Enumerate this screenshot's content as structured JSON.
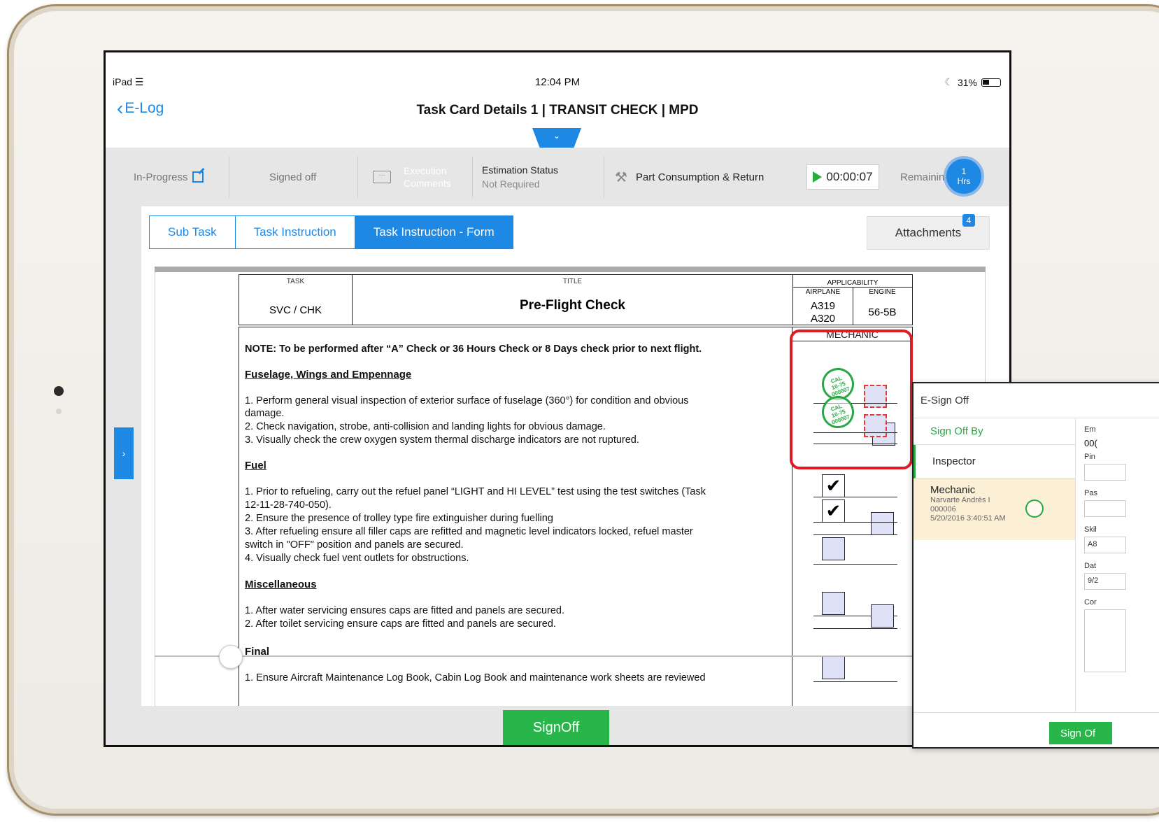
{
  "status_bar": {
    "device": "iPad",
    "time": "12:04 PM",
    "battery": "31%"
  },
  "nav": {
    "back_label": "E-Log",
    "title": "Task Card Details  1 | TRANSIT CHECK | MPD"
  },
  "toolbar": {
    "status": "In-Progress",
    "signed_off": "Signed off",
    "execution_comments": "Execution Comments",
    "estimation_label": "Estimation Status",
    "estimation_value": "Not Required",
    "part_consumption": "Part Consumption & Return",
    "timer": "00:00:07",
    "remaining_label": "Remaining",
    "remaining_value": "1",
    "remaining_unit": "Hrs"
  },
  "tabs": [
    {
      "label": "Sub Task",
      "active": false
    },
    {
      "label": "Task Instruction",
      "active": false
    },
    {
      "label": "Task Instruction - Form",
      "active": true
    }
  ],
  "attachments": {
    "label": "Attachments",
    "count": "4"
  },
  "document": {
    "header": {
      "task_label": "TASK",
      "task_value": "SVC / CHK",
      "title_label": "TITLE",
      "title_value": "Pre-Flight Check",
      "applicability_label": "APPLICABILITY",
      "airplane_label": "AIRPLANE",
      "engine_label": "ENGINE",
      "airplane_1": "A319",
      "airplane_2": "A320",
      "engine_value": "56-5B"
    },
    "mechanic_label": "MECHANIC",
    "note": "NOTE: To be performed after “A” Check or 36 Hours Check or 8 Days check prior to next flight.",
    "sections": {
      "fuselage": "Fuselage, Wings and Empennage",
      "fuselage_1a": "1.   Perform general visual inspection of exterior surface of fuselage (360°) for condition and obvious",
      "fuselage_1b": "damage.",
      "fuselage_2": "2.   Check navigation, strobe, anti-collision and landing lights for obvious damage.",
      "fuselage_3": "3.   Visually check the crew oxygen system thermal discharge indicators are not ruptured.",
      "fuel": "Fuel",
      "fuel_1a": "1.   Prior to refueling, carry out the refuel panel “LIGHT and HI LEVEL” test using the test switches (Task",
      "fuel_1b": "12-11-28-740-050).",
      "fuel_2": "2.   Ensure the presence of trolley type fire extinguisher during fuelling",
      "fuel_3a": "3.   After refueling ensure all filler caps are refitted and magnetic level indicators locked, refuel master",
      "fuel_3b": "switch in \"OFF\" position and panels are secured.",
      "fuel_4": "4.   Visually check fuel vent outlets for obstructions.",
      "misc": "Miscellaneous",
      "misc_1": "1.   After water servicing ensures caps are fitted and panels are secured.",
      "misc_2": "2.   After toilet servicing ensure caps are fitted and panels are secured.",
      "final": "Final",
      "final_1": "1.   Ensure Aircraft Maintenance Log Book, Cabin Log Book and maintenance work sheets are reviewed"
    },
    "stamp_text": [
      "CAL",
      "10-75",
      "000007"
    ]
  },
  "signoff_button": "SignOff",
  "esign": {
    "title": "E-Sign Off",
    "sign_off_by": "Sign Off By",
    "inspector": "Inspector",
    "mechanic": "Mechanic",
    "mechanic_name": "Narvarte Andrés  I",
    "mechanic_id": "000006",
    "mechanic_date": "5/20/2016 3:40:51 AM",
    "emp_label": "Em",
    "emp_value": "00(",
    "pin_label": "Pin",
    "pass_label": "Pas",
    "skill_label": "Skil",
    "skill_value": "A8",
    "date_label": "Dat",
    "date_value": "9/2",
    "comment_label": "Cor",
    "sign_button": "Sign Of"
  }
}
